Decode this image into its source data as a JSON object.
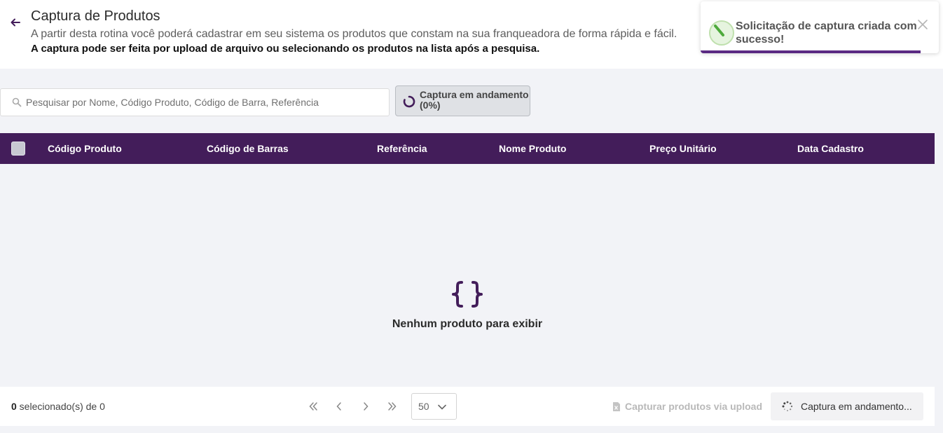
{
  "header": {
    "title": "Captura de Produtos",
    "description": "A partir desta rotina você poderá cadastrar em seu sistema os produtos que constam na sua franqueadora de forma rápida e fácil.",
    "description_bold": "A captura pode ser feita por upload de arquivo ou selecionando os produtos na lista após a pesquisa."
  },
  "toast": {
    "message": "Solicitação de captura criada com sucesso!",
    "icon": "success-check-icon",
    "accent_color": "#5a2a82"
  },
  "search": {
    "placeholder": "Pesquisar por Nome, Código Produto, Código de Barra, Referência",
    "value": ""
  },
  "capture_status": {
    "label": "Captura em andamento",
    "progress": "(0%)"
  },
  "table": {
    "columns": [
      "Código Produto",
      "Código de Barras",
      "Referência",
      "Nome Produto",
      "Preço Unitário",
      "Data Cadastro"
    ],
    "rows": [],
    "empty_message": "Nenhum produto para exibir",
    "header_color": "#431d5a"
  },
  "footer": {
    "selected_count": "0",
    "selected_suffix": " selecionado(s) de 0",
    "page_size": "50",
    "upload_label": "Capturar produtos via upload",
    "running_label": "Captura em andamento..."
  }
}
